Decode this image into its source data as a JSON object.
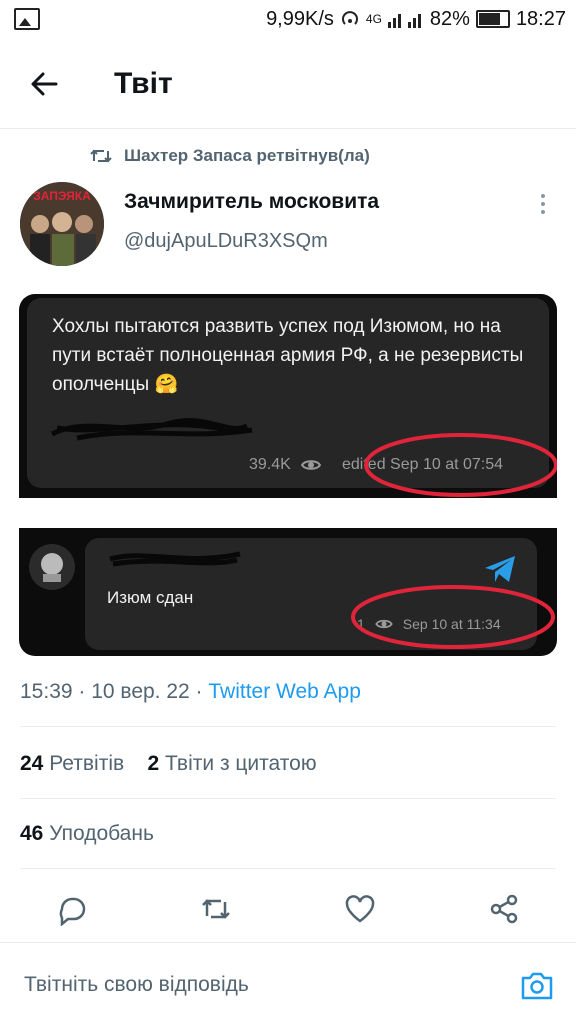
{
  "status_bar": {
    "speed": "9,99K/s",
    "network": "4G",
    "battery_pct": "82%",
    "battery_level": 0.82,
    "time": "18:27"
  },
  "header": {
    "title": "Твіт"
  },
  "retweet": {
    "text": "Шахтер Запаса ретвітнув(ла)"
  },
  "author": {
    "name": "Зачмиритель московита",
    "handle": "@dujApuLDuR3XSQm",
    "avatar_text": "ЗАПЭЯКА"
  },
  "media": {
    "msg1": {
      "text": "Хохлы пытаются развить успех под Изюмом, но на пути встаёт полноценная армия РФ, а не резервисты ополченцы 🤗",
      "views": "39.4K",
      "edited": "edited Sep 10 at 07:54"
    },
    "msg2": {
      "text": "Изюм сдан",
      "views": "1",
      "time": "Sep 10 at 11:34"
    }
  },
  "meta": {
    "time_date": "15:39 · 10 вер. 22 · ",
    "app": "Twitter Web App"
  },
  "stats": {
    "retweets_count": "24",
    "retweets_label": "Ретвітів",
    "quotes_count": "2",
    "quotes_label": "Твіти з цитатою",
    "likes_count": "46",
    "likes_label": "Уподобань"
  },
  "reply": {
    "placeholder": "Твітніть свою відповідь"
  },
  "colors": {
    "accent": "#1d9bf0",
    "secondary_text": "#536471",
    "highlight_circle": "#e0243a",
    "telegram": "#2a9de8"
  },
  "icons": [
    "back-arrow-icon",
    "retweet-icon",
    "more-vertical-icon",
    "eye-icon",
    "telegram-icon",
    "reply-icon",
    "like-icon",
    "share-icon",
    "camera-icon"
  ]
}
